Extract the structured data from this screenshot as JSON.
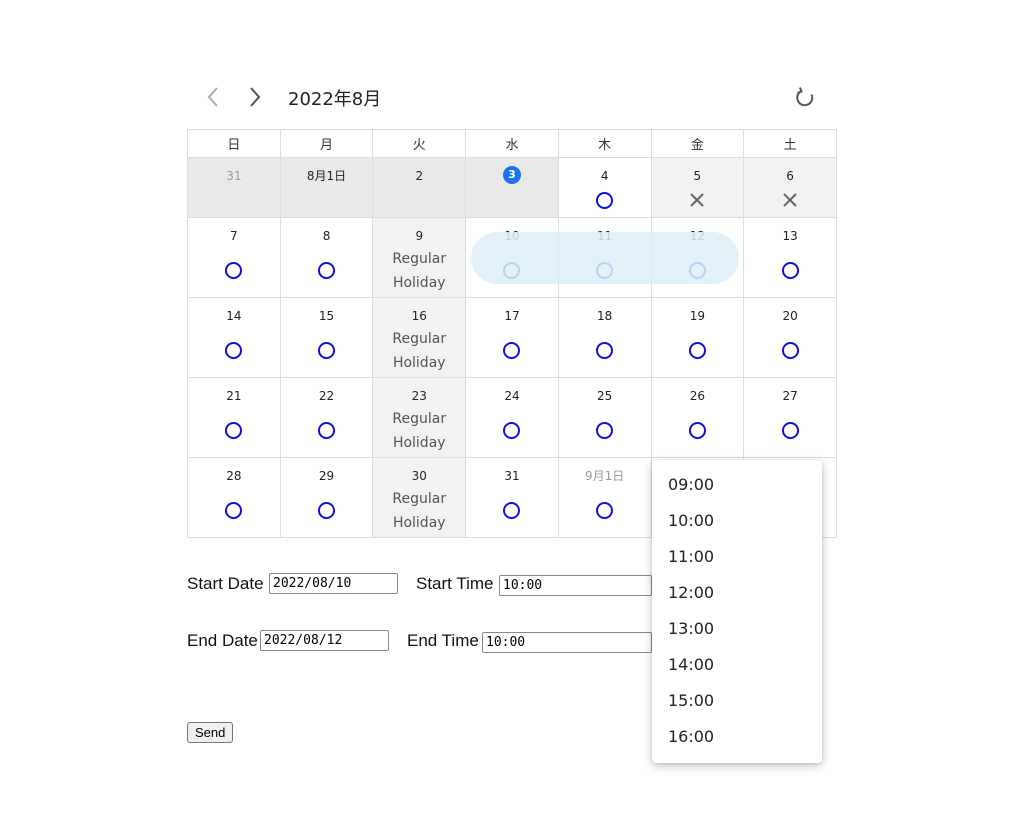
{
  "header": {
    "month_title": "2022年8月",
    "prev_icon": "chevron-left-icon",
    "next_icon": "chevron-right-icon",
    "reload_icon": "refresh-icon"
  },
  "weekdays": [
    "日",
    "月",
    "火",
    "水",
    "木",
    "金",
    "土"
  ],
  "weeks": [
    [
      {
        "day": "31",
        "muted": true,
        "shade": true
      },
      {
        "day": "8月1日",
        "shade": true
      },
      {
        "day": "2",
        "shade": true
      },
      {
        "day": "3",
        "today": true,
        "shade": true
      },
      {
        "day": "4",
        "mark": "circle"
      },
      {
        "day": "5",
        "mark": "cross",
        "light": true
      },
      {
        "day": "6",
        "mark": "cross",
        "light": true
      }
    ],
    [
      {
        "day": "7",
        "mark": "circle"
      },
      {
        "day": "8",
        "mark": "circle"
      },
      {
        "day": "9",
        "holiday": "Regular Holiday"
      },
      {
        "day": "10",
        "mark": "circle"
      },
      {
        "day": "11",
        "mark": "circle"
      },
      {
        "day": "12",
        "mark": "circle"
      },
      {
        "day": "13",
        "mark": "circle"
      }
    ],
    [
      {
        "day": "14",
        "mark": "circle"
      },
      {
        "day": "15",
        "mark": "circle"
      },
      {
        "day": "16",
        "holiday": "Regular Holiday"
      },
      {
        "day": "17",
        "mark": "circle"
      },
      {
        "day": "18",
        "mark": "circle"
      },
      {
        "day": "19",
        "mark": "circle"
      },
      {
        "day": "20",
        "mark": "circle"
      }
    ],
    [
      {
        "day": "21",
        "mark": "circle"
      },
      {
        "day": "22",
        "mark": "circle"
      },
      {
        "day": "23",
        "holiday": "Regular Holiday"
      },
      {
        "day": "24",
        "mark": "circle"
      },
      {
        "day": "25",
        "mark": "circle"
      },
      {
        "day": "26",
        "mark": "circle"
      },
      {
        "day": "27",
        "mark": "circle"
      }
    ],
    [
      {
        "day": "28",
        "mark": "circle"
      },
      {
        "day": "29",
        "mark": "circle"
      },
      {
        "day": "30",
        "holiday": "Regular Holiday"
      },
      {
        "day": "31",
        "mark": "circle"
      },
      {
        "day": "9月1日",
        "muted": true,
        "mark": "circle"
      },
      {
        "day": "",
        "hidden": true
      },
      {
        "day": "",
        "hidden": true
      }
    ]
  ],
  "form": {
    "start_date_label": "Start Date",
    "start_date_value": "2022/08/10",
    "start_time_label": "Start Time",
    "start_time_value": "10:00",
    "end_date_label": "End Date",
    "end_date_value": "2022/08/12",
    "end_time_label": "End Time",
    "end_time_value": "10:00",
    "send_label": "Send"
  },
  "time_dropdown": {
    "options": [
      "09:00",
      "10:00",
      "11:00",
      "12:00",
      "13:00",
      "14:00",
      "15:00",
      "16:00"
    ]
  },
  "colors": {
    "today": "#1a73e8",
    "available_mark": "#1010e0",
    "unavailable_mark": "#666666",
    "selected_range": "#ddeef7"
  }
}
